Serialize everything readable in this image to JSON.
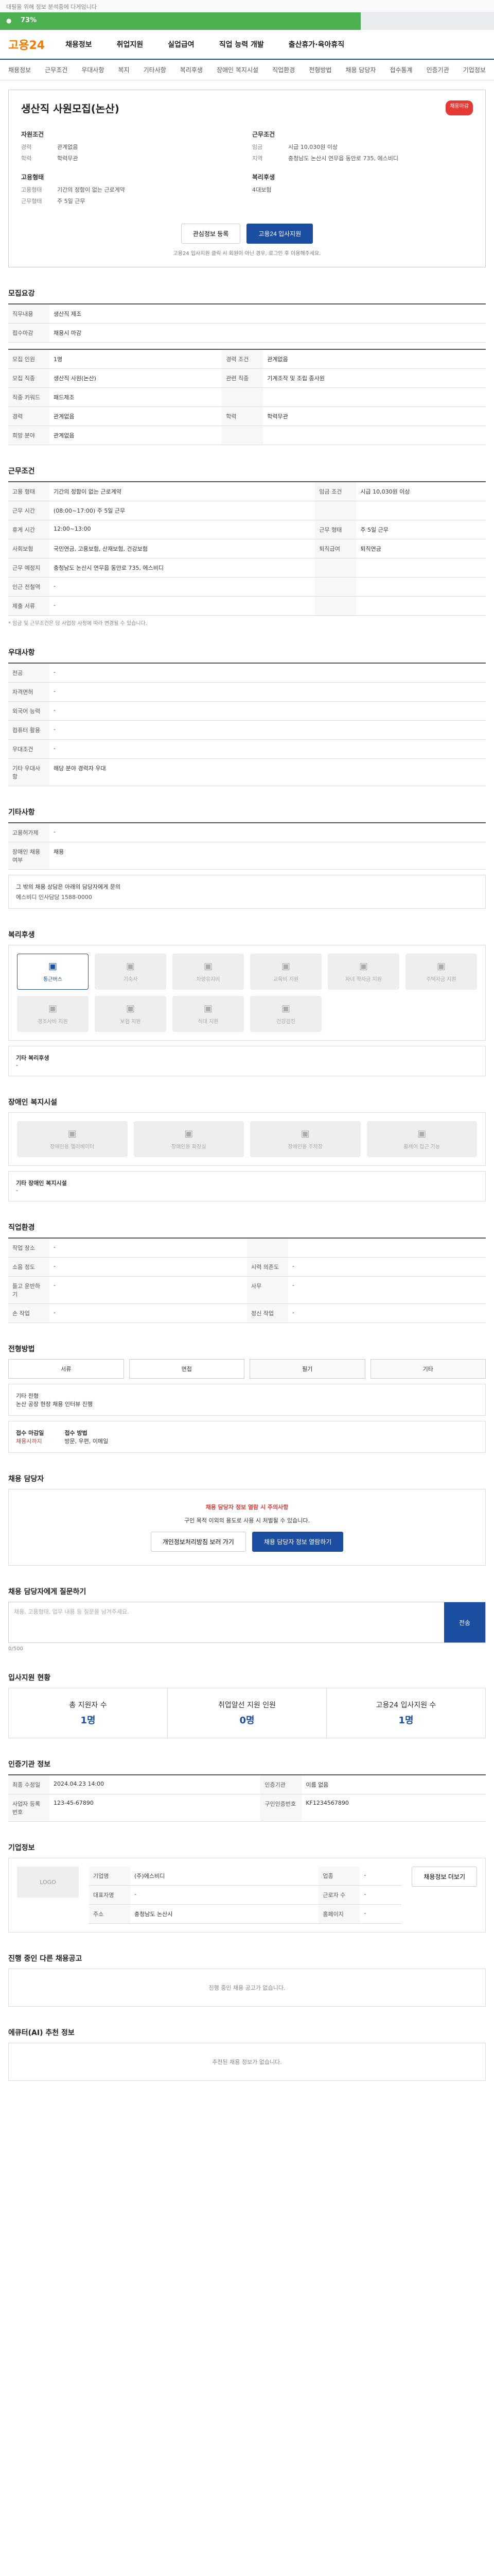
{
  "topbar": {
    "text": "대필을 위해 정보 분석중에 다게임니다"
  },
  "progress": {
    "label": "73%",
    "fraction": 0.73,
    "color": "#4caf50"
  },
  "header": {
    "logo": "고용24",
    "logo_mark": "24",
    "nav": [
      "채용정보",
      "취업지원",
      "실업급여",
      "직업 능력 개발",
      "출산휴가·육아휴직"
    ]
  },
  "lnb": [
    "채용정보",
    "근무조건",
    "우대사항",
    "복지",
    "기타사항",
    "복리후생",
    "장애인 복지시설",
    "직업환경",
    "전형방법",
    "채용 담당자",
    "접수통계",
    "인증기관",
    "기업정보"
  ],
  "post": {
    "title": "생산직 사원모집(논산)",
    "badge": "채용마감",
    "company_h": "자원조건",
    "work_h": "근무조건",
    "company": [
      [
        "경력",
        "관계없음"
      ],
      [
        "학력",
        "학력무관"
      ]
    ],
    "work": [
      [
        "임금",
        "시급 10,030원 이상"
      ],
      [
        "지역",
        "충청남도 논산시 연무읍 동안로 735, 에스비디"
      ]
    ],
    "etc_h1": "고용형태",
    "etc_h2": "복리후생",
    "etc": [
      [
        "고용형태",
        "기간의 정함이 없는 근로계약"
      ],
      [
        "근무형태",
        "주 5일 근무"
      ]
    ],
    "etc2": "4대보험",
    "btn_scrap": "관심정보 등록",
    "btn_apply": "고용24 입사지원",
    "note": "고용24 입사지원 클릭 시 회원이 아닌 경우, 로그인 후 이용해주세요."
  },
  "recruit": {
    "h": "모집요강",
    "intro": [
      [
        "직무내용",
        "생산직 제조"
      ],
      [
        "접수마감",
        "채용시 마감"
      ]
    ],
    "rows": [
      [
        "모집 인원",
        "1명",
        "경력 조건",
        "관계없음"
      ],
      [
        "모집 직종",
        "생산직 사원(논산)",
        "관련 직종",
        "기계조작 및 조립 종사원"
      ],
      [
        "직종 키워드",
        "패드제조",
        "",
        ""
      ],
      [
        "경력",
        "관계없음",
        "학력",
        "학력무관"
      ],
      [
        "희망 분야",
        "관계없음",
        "",
        ""
      ]
    ]
  },
  "cond": {
    "h": "근무조건",
    "rows": [
      [
        "고용 형태",
        "기간의 정함이 없는 근로계약",
        "임금 조건",
        "시급 10,030원 이상"
      ],
      [
        "근무 시간",
        "(08:00~17:00) 주 5일 근무",
        "",
        ""
      ],
      [
        "휴게 시간",
        "12:00~13:00",
        "근무 형태",
        "주 5일 근무"
      ],
      [
        "사회보험",
        "국민연금, 고용보험, 산재보험, 건강보험",
        "퇴직급여",
        "퇴직연금"
      ],
      [
        "근무 예정지",
        "충청남도 논산시 연무읍 동안로 735, 에스비디",
        "",
        ""
      ],
      [
        "인근 전철역",
        "-",
        "",
        ""
      ],
      [
        "제출 서류",
        "-",
        "",
        ""
      ]
    ],
    "note": "* 임금 및 근무조건은 당 사업장 사정에 따라 변경될 수 있습니다."
  },
  "pref": {
    "h": "우대사항",
    "rows": [
      [
        "전공",
        "-"
      ],
      [
        "자격면허",
        "-"
      ],
      [
        "외국어 능력",
        "-"
      ],
      [
        "컴퓨터 활용",
        "-"
      ],
      [
        "우대조건",
        "-"
      ],
      [
        "기타 우대사항",
        "해당 분야 경력자 우대"
      ]
    ]
  },
  "other": {
    "h": "기타사항",
    "rows": [
      [
        "고용허가제",
        "-"
      ],
      [
        "장애인 채용 여부",
        "채용"
      ]
    ],
    "contact": "그 밖의 채용 상담은 아래의 담당자에게 문의",
    "c2": "에스비디 인사담당 1588-0000"
  },
  "welfare": {
    "h": "복리후생",
    "items": [
      "통근버스",
      "기숙사",
      "차량유지비",
      "교육비 지원",
      "자녀 학자금 지원",
      "주택자금 지원",
      "경조사비 지원",
      "보험 지원",
      "식대 지원",
      "건강검진"
    ],
    "extra_h": "기타 복리후생",
    "extra": "-"
  },
  "disab": {
    "h": "장애인 복지시설",
    "items": [
      "장애인용 엘리베이터",
      "장애인용 화장실",
      "장애인용 주차장",
      "휠체어 접근 가능"
    ],
    "note_h": "기타 장애인 복지시설",
    "note": "-"
  },
  "env": {
    "h": "직업환경",
    "rows": [
      [
        "작업 장소",
        "-",
        "",
        ""
      ],
      [
        "소음 정도",
        "-",
        "시력 의존도",
        "-"
      ],
      [
        "들고 운반하기",
        "-",
        "사무",
        "-"
      ],
      [
        "손 작업",
        "-",
        "정신 작업",
        "-"
      ]
    ]
  },
  "sel": {
    "h": "전형방법",
    "chips": [
      "서류",
      "면접",
      "필기",
      "기타"
    ],
    "d1": "기타 전형",
    "d2": "논산 공장 현장 채용 인터뷰 진행"
  },
  "apply": {
    "h": "접수 마감일",
    "deadline": "채용시까지",
    "left": "접수 방법",
    "right": "방문, 우편, 이메일"
  },
  "mgr": {
    "h": "채용 담당자",
    "warn": "채용 담당자 정보 열람 시 주의사항",
    "w2": "구인 목적 이외의 용도로 사용 시 처벌될 수 있습니다.",
    "b1": "개인정보처리방침 보러 가기",
    "b2": "채용 담당자 정보 열람하기"
  },
  "qa": {
    "h": "채용 담당자에게 질문하기",
    "ph": "채용, 고용형태, 업무 내용 등 질문을 남겨주세요.",
    "submit": "전송",
    "count": "0/500"
  },
  "stats": {
    "h": "입사지원 현황",
    "items": [
      [
        "총 지원자 수",
        "1명"
      ],
      [
        "취업알선 지원 인원",
        "0명"
      ],
      [
        "고용24 입사지원 수",
        "1명"
      ]
    ]
  },
  "cert": {
    "h": "인증기관 정보",
    "rows": [
      [
        "최종 수정일",
        "2024.04.23 14:00",
        "인증기관",
        "이름 없음"
      ],
      [
        "사업자 등록번호",
        "123-45-67890",
        "구인인증번호",
        "KF1234567890"
      ]
    ]
  },
  "comp": {
    "h": "기업정보",
    "logo": "LOGO",
    "rows": [
      [
        "기업명",
        "(주)에스비디",
        "업종",
        "-"
      ],
      [
        "대표자명",
        "-",
        "근로자 수",
        "-"
      ],
      [
        "주소",
        "충청남도 논산시",
        "홈페이지",
        "-"
      ]
    ],
    "btn": "채용정보 더보기"
  },
  "same": {
    "h": "진행 중인 다른 채용공고",
    "empty": "진행 중인 채용 공고가 없습니다."
  },
  "rec": {
    "h": "에큐터(AI) 추천 정보",
    "empty": "추천된 채용 정보가 없습니다."
  }
}
